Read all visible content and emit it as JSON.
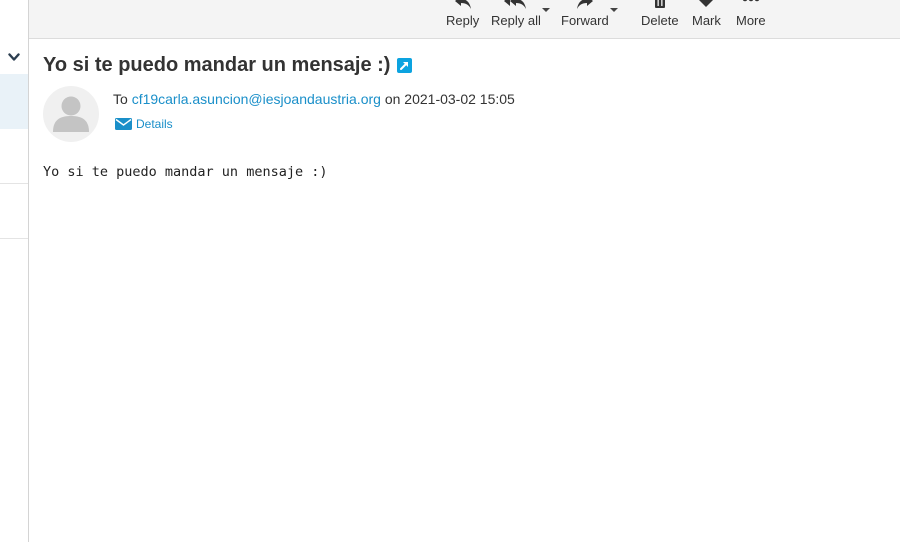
{
  "toolbar": {
    "reply_label": "Reply",
    "reply_all_label": "Reply all",
    "forward_label": "Forward",
    "delete_label": "Delete",
    "mark_label": "Mark",
    "more_label": "More"
  },
  "message": {
    "subject": "Yo si te puedo mandar un mensaje :)",
    "to_prefix": "To",
    "recipient": "cf19carla.asuncion@iesjoandaustria.org",
    "date_prefix": "on",
    "date": "2021-03-02 15:05",
    "details_label": "Details",
    "body": "Yo si te puedo mandar un mensaje :)"
  },
  "icons": {
    "reply": "reply-icon",
    "reply_all": "reply-all-icon",
    "forward": "forward-icon",
    "delete": "trash-icon",
    "mark": "heart-icon",
    "more": "ellipsis-icon",
    "open_external": "open-in-new-window-icon",
    "details": "envelope-icon",
    "collapse": "chevron-down-icon"
  },
  "colors": {
    "accent": "#0ca3e0",
    "link": "#1a8fc9",
    "toolbar_bg": "#f4f4f4",
    "selected_row": "#e9f2f8"
  }
}
